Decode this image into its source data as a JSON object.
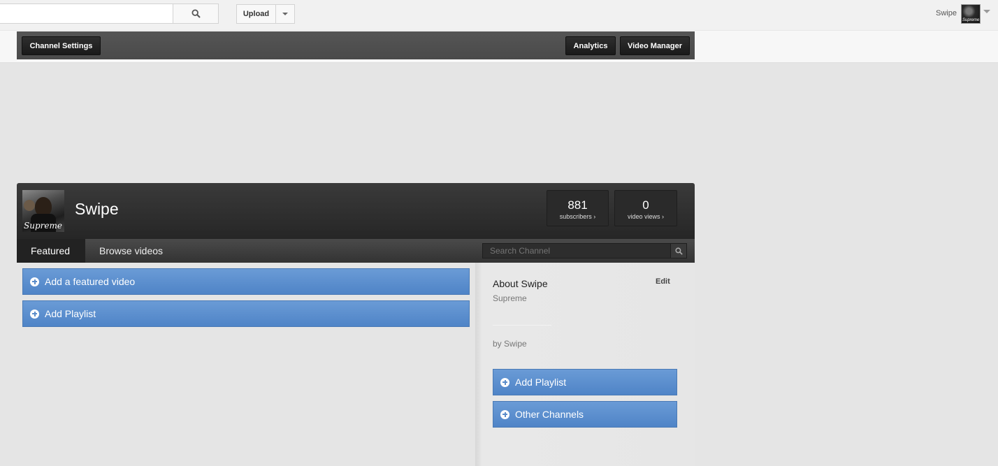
{
  "masthead": {
    "search_placeholder": "",
    "upload_label": "Upload",
    "user_name": "Swipe",
    "user_avatar_caption": "Supreme"
  },
  "toolbar": {
    "channel_settings": "Channel Settings",
    "analytics": "Analytics",
    "video_manager": "Video Manager"
  },
  "channel": {
    "name": "Swipe",
    "avatar_caption": "Supreme",
    "subscribers_count": "881",
    "subscribers_label": "subscribers ›",
    "views_count": "0",
    "views_label": "video views ›"
  },
  "tabs": [
    {
      "label": "Featured",
      "active": true
    },
    {
      "label": "Browse videos",
      "active": false
    }
  ],
  "channel_search": {
    "placeholder": "Search Channel"
  },
  "main": {
    "add_featured_video": "Add a featured video",
    "add_playlist": "Add Playlist"
  },
  "sidebar": {
    "about_title": "About Swipe",
    "edit_label": "Edit",
    "description": "Supreme",
    "by_line": "by Swipe",
    "add_playlist": "Add Playlist",
    "other_channels": "Other Channels"
  },
  "colors": {
    "accent_blue": "#5a8cca",
    "header_dark": "#2f2f2f",
    "background": "#e5e5e5"
  }
}
